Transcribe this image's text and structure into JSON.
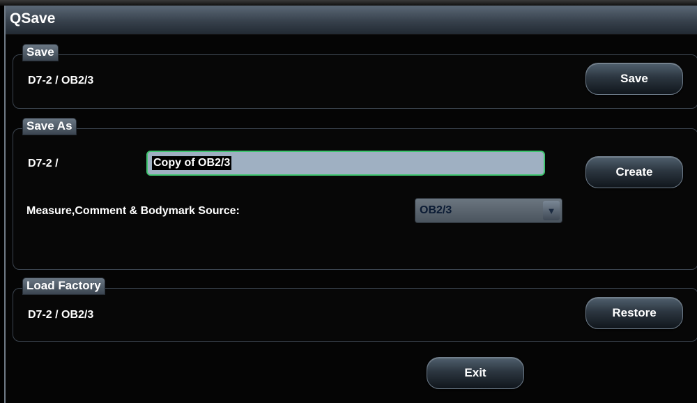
{
  "window": {
    "title": "QSave"
  },
  "save": {
    "label": "Save",
    "path": "D7-2  /  OB2/3",
    "button": "Save"
  },
  "save_as": {
    "label": "Save As",
    "prefix": "D7-2  /",
    "name_value": "Copy of  OB2/3",
    "source_label": "Measure,Comment & Bodymark Source:",
    "source_value": "OB2/3",
    "button": "Create"
  },
  "load_factory": {
    "label": "Load Factory",
    "path": "D7-2  /  OB2/3",
    "button": "Restore"
  },
  "exit_button": "Exit",
  "icons": {
    "dropdown": "chevron-down-icon"
  },
  "colors": {
    "input_focus_border": "#3fc56f",
    "title_bar": "#4a5663"
  }
}
